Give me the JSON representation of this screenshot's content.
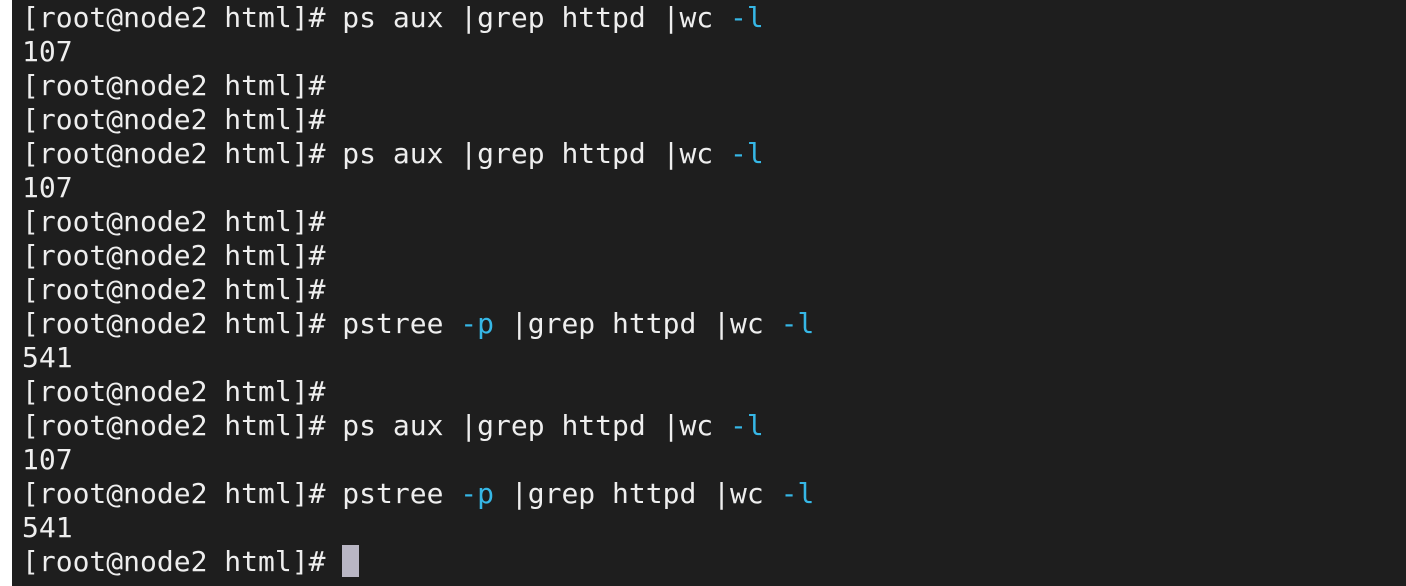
{
  "terminal": {
    "colors": {
      "background": "#1e1e1e",
      "text": "#eeeeee",
      "option_flag": "#36b7e6",
      "cursor": "#b9b6c4"
    },
    "lines": [
      {
        "type": "command",
        "prompt": "[root@node2 html]#",
        "segments": [
          {
            "text": " ps aux |grep httpd |wc "
          },
          {
            "text": "-l",
            "flag": true
          }
        ]
      },
      {
        "type": "output",
        "text": "107"
      },
      {
        "type": "command",
        "prompt": "[root@node2 html]#",
        "segments": []
      },
      {
        "type": "command",
        "prompt": "[root@node2 html]#",
        "segments": []
      },
      {
        "type": "command",
        "prompt": "[root@node2 html]#",
        "segments": [
          {
            "text": " ps aux |grep httpd |wc "
          },
          {
            "text": "-l",
            "flag": true
          }
        ]
      },
      {
        "type": "output",
        "text": "107"
      },
      {
        "type": "command",
        "prompt": "[root@node2 html]#",
        "segments": []
      },
      {
        "type": "command",
        "prompt": "[root@node2 html]#",
        "segments": []
      },
      {
        "type": "command",
        "prompt": "[root@node2 html]#",
        "segments": []
      },
      {
        "type": "command",
        "prompt": "[root@node2 html]#",
        "segments": [
          {
            "text": " pstree "
          },
          {
            "text": "-p",
            "flag": true
          },
          {
            "text": " |grep httpd |wc "
          },
          {
            "text": "-l",
            "flag": true
          }
        ]
      },
      {
        "type": "output",
        "text": "541"
      },
      {
        "type": "command",
        "prompt": "[root@node2 html]#",
        "segments": []
      },
      {
        "type": "command",
        "prompt": "[root@node2 html]#",
        "segments": [
          {
            "text": " ps aux |grep httpd |wc "
          },
          {
            "text": "-l",
            "flag": true
          }
        ]
      },
      {
        "type": "output",
        "text": "107"
      },
      {
        "type": "command",
        "prompt": "[root@node2 html]#",
        "segments": [
          {
            "text": " pstree "
          },
          {
            "text": "-p",
            "flag": true
          },
          {
            "text": " |grep httpd |wc "
          },
          {
            "text": "-l",
            "flag": true
          }
        ]
      },
      {
        "type": "output",
        "text": "541"
      },
      {
        "type": "command",
        "prompt": "[root@node2 html]#",
        "segments": [
          {
            "text": " "
          }
        ],
        "cursor": true
      }
    ]
  }
}
